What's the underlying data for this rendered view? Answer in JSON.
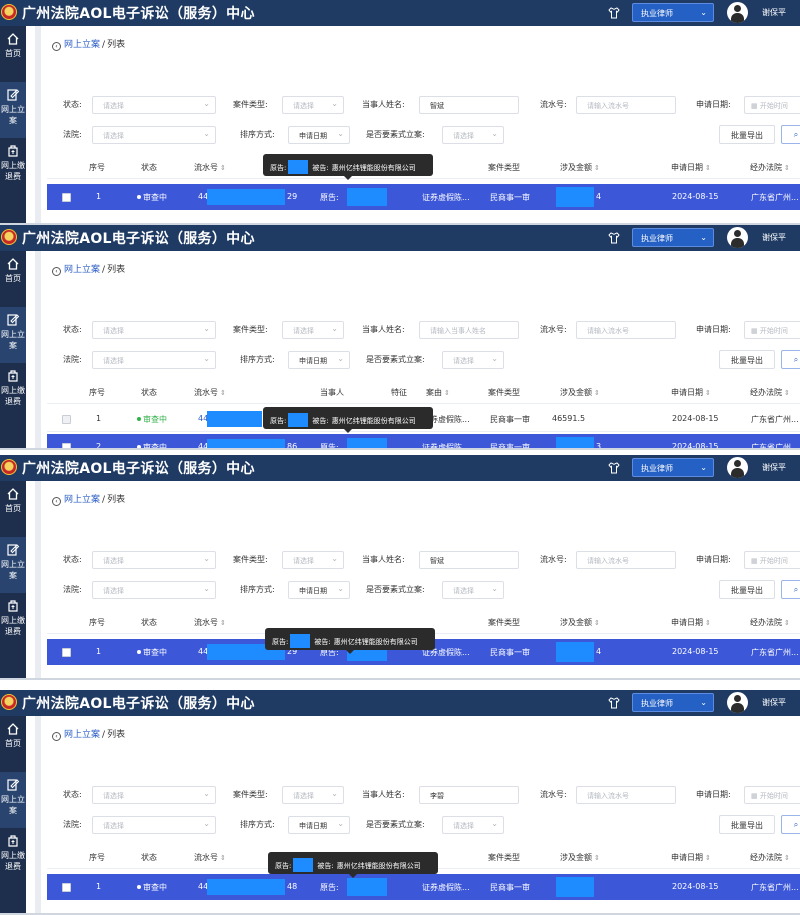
{
  "app": {
    "title": "广州法院AOL电子诉讼（服务）中心",
    "role_select": "执业律师",
    "user_name": "谢保平"
  },
  "sidebar": {
    "items": [
      {
        "label": "首页",
        "icon": "home-icon"
      },
      {
        "label": "网上立案",
        "icon": "edit-icon"
      },
      {
        "label": "网上缴退费",
        "icon": "payment-icon"
      }
    ]
  },
  "breadcrumb": {
    "link": "网上立案",
    "separator": "/",
    "current": "列表"
  },
  "filters": {
    "status_label": "状态:",
    "case_type_label": "案件类型:",
    "party_name_label": "当事人姓名:",
    "serial_label": "流水号:",
    "apply_date_label": "申请日期:",
    "court_label": "法院:",
    "sort_label": "排序方式:",
    "expedited_label": "是否要素式立案:",
    "select_placeholder": "请选择",
    "serial_placeholder": "请输入流水号",
    "party_placeholder": "请输入当事人姓名",
    "start_date_placeholder": "开始时间",
    "sort_value": "申请日期",
    "export_label": "批量导出"
  },
  "columns": {
    "index": "序号",
    "status": "状态",
    "serial": "流水号",
    "party": "当事人",
    "feature": "特征",
    "cause": "案由",
    "case_type": "案件类型",
    "amount": "涉及金额",
    "apply_date": "申请日期",
    "court": "经办法院"
  },
  "tooltip": {
    "plaintiff_label": "原告:",
    "defendant_label": "被告:",
    "defendant_name": "惠州亿纬锂能股份有限公司"
  },
  "panels": [
    {
      "party_filter": "智斌",
      "rows": [
        {
          "index": "1",
          "status": "审查中",
          "serial_prefix": "44",
          "serial_suffix": "29",
          "party_label": "原告:",
          "cause": "证券虚假陈...",
          "case_type": "民商事一审",
          "amount_suffix": "4",
          "apply_date": "2024-08-15",
          "court": "广东省广州...",
          "selected": true
        }
      ]
    },
    {
      "party_filter": "",
      "rows": [
        {
          "index": "1",
          "status": "审查中",
          "serial_prefix": "44",
          "serial_suffix": "",
          "party_label": "",
          "cause": "证券虚假陈...",
          "case_type": "民商事一审",
          "amount": "46591.5",
          "apply_date": "2024-08-15",
          "court": "广东省广州...",
          "selected": false
        },
        {
          "index": "2",
          "status": "审查中",
          "serial_prefix": "44",
          "serial_suffix": "86",
          "party_label": "原告:",
          "cause": "证券虚假陈...",
          "case_type": "民商事一审",
          "amount_suffix": "3",
          "apply_date": "2024-08-15",
          "court": "广东省广州...",
          "selected": true
        }
      ]
    },
    {
      "party_filter": "智斌",
      "rows": [
        {
          "index": "1",
          "status": "审查中",
          "serial_prefix": "44",
          "serial_suffix": "29",
          "party_label": "原告:",
          "cause": "证券虚假陈...",
          "case_type": "民商事一审",
          "amount_suffix": "4",
          "apply_date": "2024-08-15",
          "court": "广东省广州...",
          "selected": true
        }
      ]
    },
    {
      "party_filter": "李碧",
      "rows": [
        {
          "index": "1",
          "status": "审查中",
          "serial_prefix": "44",
          "serial_suffix": "48",
          "party_label": "原告:",
          "cause": "证券虚假陈...",
          "case_type": "民商事一审",
          "amount_suffix": "",
          "apply_date": "2024-08-15",
          "court": "广东省广州...",
          "selected": true
        }
      ]
    }
  ]
}
